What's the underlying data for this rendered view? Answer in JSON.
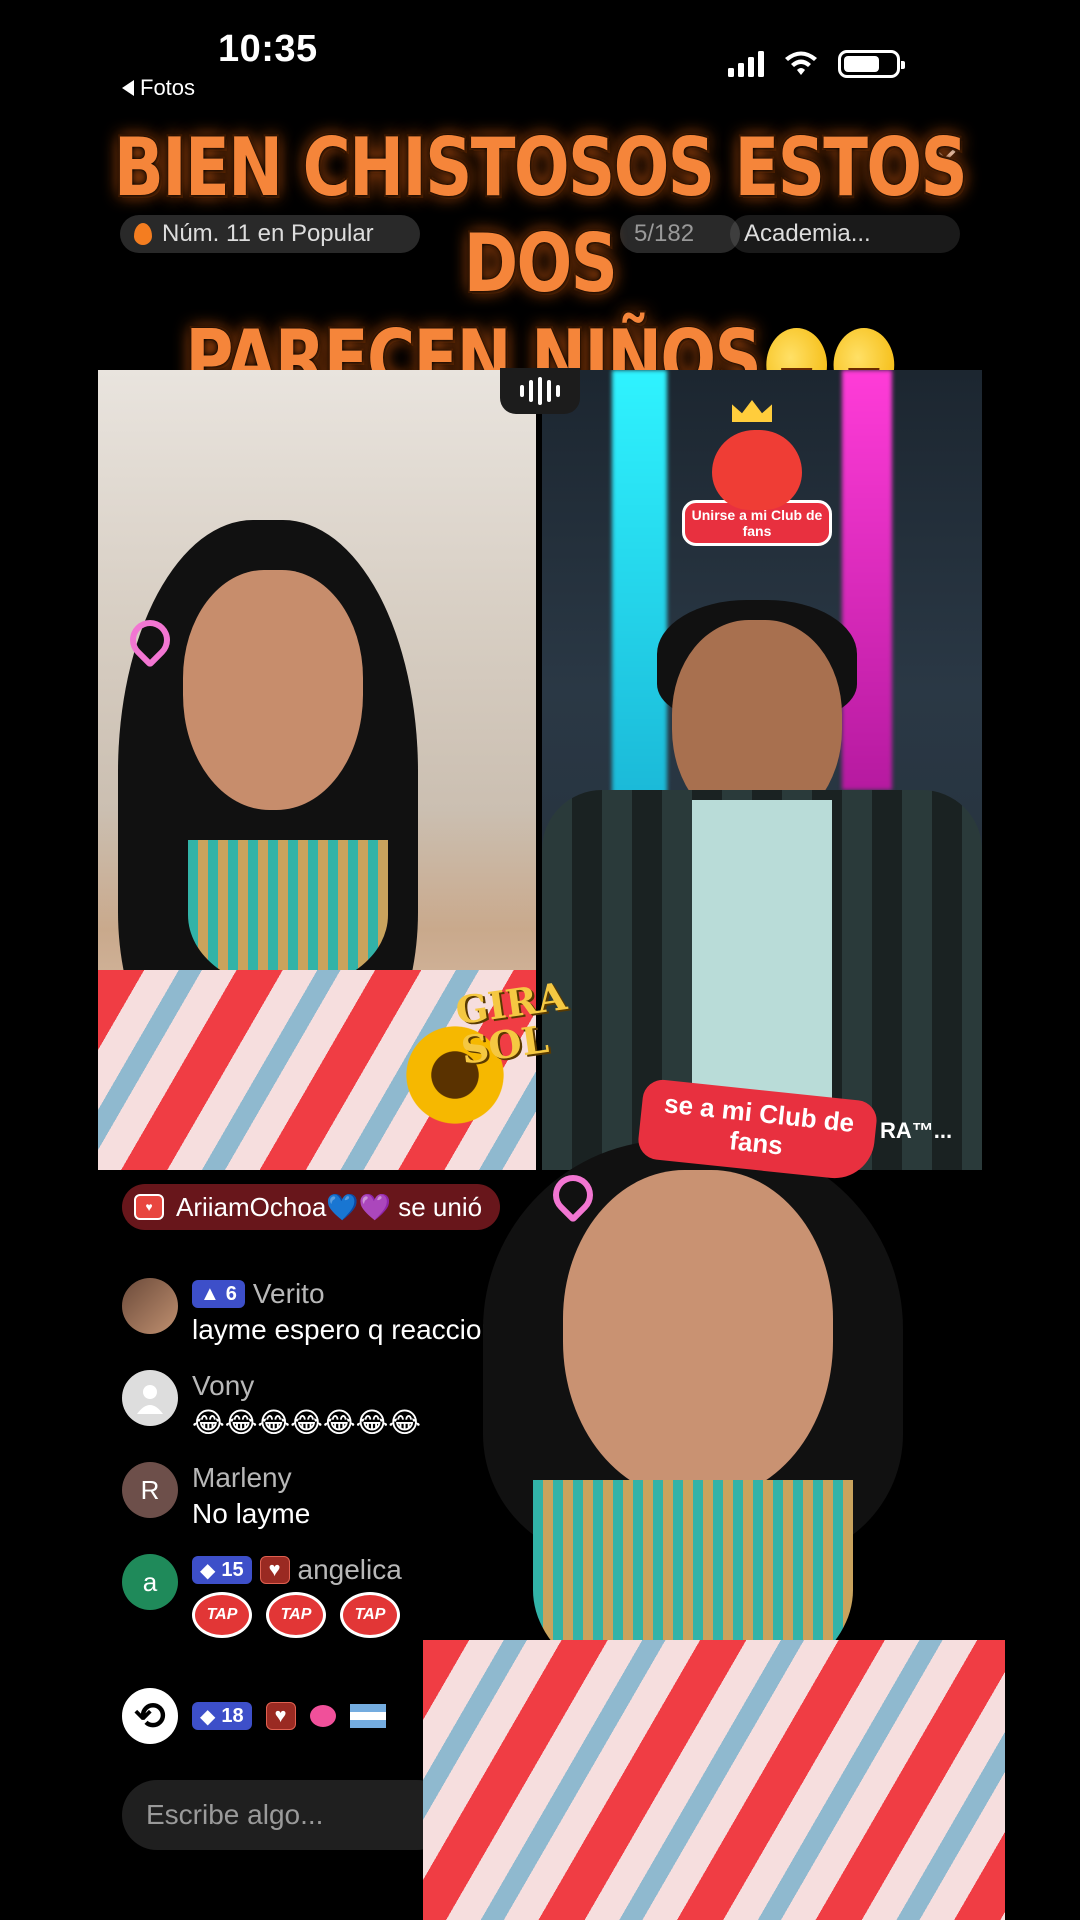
{
  "status_bar": {
    "time": "10:35",
    "back_label": "Fotos",
    "icons": [
      "signal-icon",
      "wifi-icon",
      "battery-icon"
    ]
  },
  "live_header": {
    "ranking": "Núm. 11 en Popular",
    "viewer_count": "5/182",
    "team": "Academia..."
  },
  "caption": {
    "line1": "BIEN CHISTOSOS ESTOS DOS",
    "line2": "PARECEN NIÑOS"
  },
  "battle": {
    "fanclub_label": "Unirse a mi Club de fans",
    "sticker_text": "GIRA SOL",
    "right_name": "RA™..."
  },
  "join_banner": {
    "text": "AriiamOchoa💙💜 se unió"
  },
  "chat": [
    {
      "name": "Verito",
      "level": "6",
      "message": "layme espero q reaccione",
      "avatar_letter": ""
    },
    {
      "name": "Vony",
      "level": "",
      "message": "😂😂😂😂😂😂😂",
      "avatar_letter": ""
    },
    {
      "name": "Marleny",
      "level": "",
      "message": "No layme",
      "avatar_letter": "R"
    },
    {
      "name": "angelica",
      "level": "15",
      "message": "TAP TAP TAP",
      "avatar_letter": "a"
    }
  ],
  "bottom_strip": {
    "level": "18"
  },
  "comment_input": {
    "placeholder": "Escribe algo..."
  },
  "overlay": {
    "fanclub_text": "se a mi Club de fans"
  },
  "colors": {
    "caption_orange": "#f5853a",
    "badge_blue": "#3d4fc9",
    "join_red": "#be2832"
  }
}
